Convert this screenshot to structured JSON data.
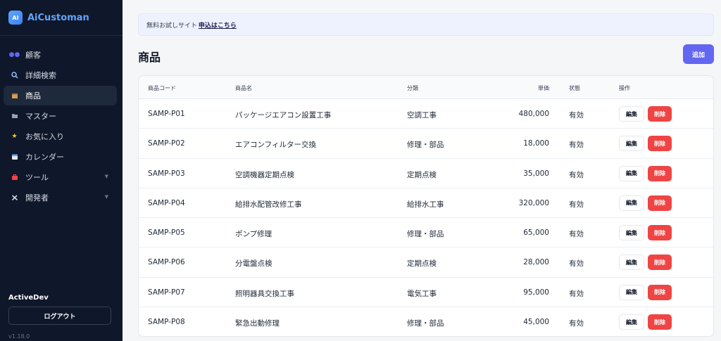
{
  "app": {
    "logo_text": "AI",
    "name": "AiCustoman"
  },
  "sidebar": {
    "items": [
      {
        "label": "顧客",
        "icon": "users-icon"
      },
      {
        "label": "詳細検索",
        "icon": "search-icon"
      },
      {
        "label": "商品",
        "icon": "box-icon",
        "active": true
      },
      {
        "label": "マスター",
        "icon": "folder-icon"
      },
      {
        "label": "お気に入り",
        "icon": "star-icon"
      },
      {
        "label": "カレンダー",
        "icon": "calendar-icon"
      },
      {
        "label": "ツール",
        "icon": "toolbox-icon",
        "has_children": true
      },
      {
        "label": "開発者",
        "icon": "tools-icon",
        "has_children": true
      }
    ],
    "user_name": "ActiveDev",
    "logout_label": "ログアウト",
    "version": "v1.18.0"
  },
  "banner": {
    "text": "無料お試しサイト",
    "link_text": "申込はこちら"
  },
  "page": {
    "title": "商品",
    "add_label": "追加"
  },
  "table": {
    "headers": {
      "code": "商品コード",
      "name": "商品名",
      "category": "分類",
      "price": "単価",
      "status": "状態",
      "ops": "操作"
    },
    "edit_label": "編集",
    "delete_label": "削除",
    "rows": [
      {
        "code": "SAMP-P01",
        "name": "パッケージエアコン設置工事",
        "category": "空調工事",
        "price": "480,000",
        "status": "有効"
      },
      {
        "code": "SAMP-P02",
        "name": "エアコンフィルター交換",
        "category": "修理・部品",
        "price": "18,000",
        "status": "有効"
      },
      {
        "code": "SAMP-P03",
        "name": "空調機器定期点検",
        "category": "定期点検",
        "price": "35,000",
        "status": "有効"
      },
      {
        "code": "SAMP-P04",
        "name": "給排水配管改修工事",
        "category": "給排水工事",
        "price": "320,000",
        "status": "有効"
      },
      {
        "code": "SAMP-P05",
        "name": "ポンプ修理",
        "category": "修理・部品",
        "price": "65,000",
        "status": "有効"
      },
      {
        "code": "SAMP-P06",
        "name": "分電盤点検",
        "category": "定期点検",
        "price": "28,000",
        "status": "有効"
      },
      {
        "code": "SAMP-P07",
        "name": "照明器具交換工事",
        "category": "電気工事",
        "price": "95,000",
        "status": "有効"
      },
      {
        "code": "SAMP-P08",
        "name": "緊急出動修理",
        "category": "修理・部品",
        "price": "45,000",
        "status": "有効"
      }
    ]
  },
  "colors": {
    "sidebar_bg": "#0f172a",
    "accent": "#6366f1",
    "danger": "#ef4444"
  }
}
